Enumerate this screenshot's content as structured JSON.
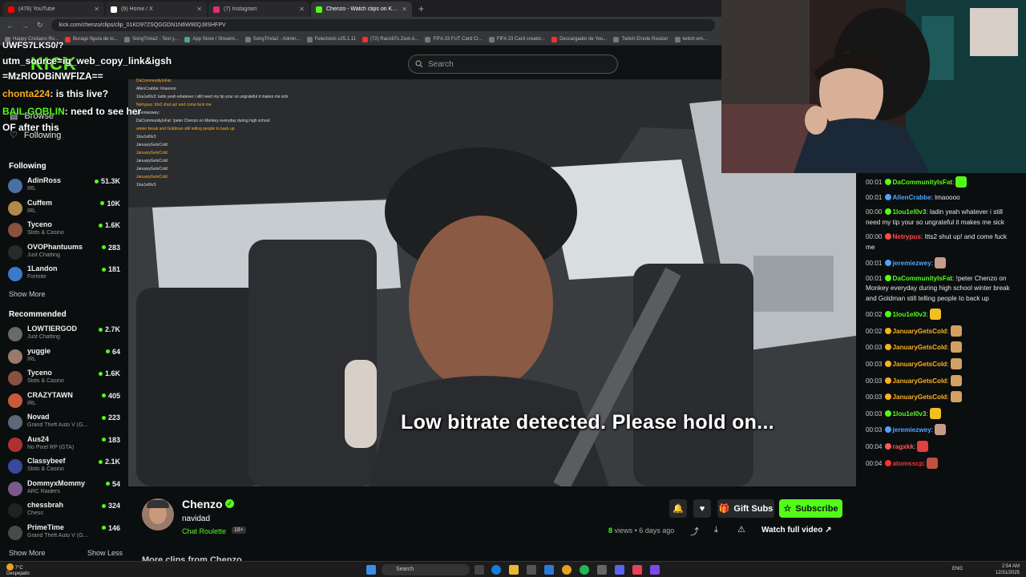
{
  "browser": {
    "tabs": [
      {
        "label": "(478) YouTube",
        "color": "#ff0000"
      },
      {
        "label": "(6) Home / X",
        "color": "#ffffff"
      },
      {
        "label": "(7) Instagram",
        "color": "#e1306c"
      },
      {
        "label": "Chenzo - Watch clips on Kick",
        "color": "#53fc18",
        "active": true
      }
    ],
    "url": "kick.com/chenzo/clips/clip_01KD97ZSQGGDN1N6W90QJ8SHFPV",
    "bookmarks": [
      "Happy Cristiano Ro...",
      "Burago figura de to...",
      "SongTrivia2 - Test y...",
      "App Store / Streami...",
      "SongTrivia2 - Admin...",
      "Felectools v25.1.11",
      "(72) Raco87s Zest-A...",
      "FIFA 23 FUT Card Cr...",
      "FIFA 23 Card creator...",
      "Descargador de You...",
      "Twitch Emote Resizer",
      "twitch em..."
    ]
  },
  "overlay": {
    "line1": "UWFS7LKS0/?",
    "line2": "utm_source=ig_web_copy_link&igsh",
    "line3": "=MzRlODBiNWFlZA==",
    "msg1_user": "chonta224",
    "msg1_text": ": is this live?",
    "msg2_user": "BAIL GOBLIN",
    "msg2_text": ": need to see her",
    "msg3": "OF after this"
  },
  "search": {
    "placeholder": "Search"
  },
  "sidebar": {
    "browse": "Browse",
    "following_nav": "Following",
    "following_title": "Following",
    "following": [
      {
        "name": "AdinRoss",
        "game": "IRL",
        "viewers": "51.3K",
        "color": "#4a6fa5"
      },
      {
        "name": "Cuffem",
        "game": "IRL",
        "viewers": "10K",
        "color": "#b08a4a"
      },
      {
        "name": "Tyceno",
        "game": "Slots & Casino",
        "viewers": "1.6K",
        "color": "#8a5040"
      },
      {
        "name": "OVOPhantuums",
        "game": "Just Chatting",
        "viewers": "283",
        "color": "#2a2a2a"
      },
      {
        "name": "1Landon",
        "game": "Fortnite",
        "viewers": "181",
        "color": "#3a7ac8"
      }
    ],
    "show_more_1": "Show More",
    "recommended_title": "Recommended",
    "recommended": [
      {
        "name": "LOWTIERGOD",
        "game": "Just Chatting",
        "viewers": "2.7K",
        "color": "#6a6a6a"
      },
      {
        "name": "yuggie",
        "game": "IRL",
        "viewers": "64",
        "color": "#9a7a6a"
      },
      {
        "name": "Tyceno",
        "game": "Slots & Casino",
        "viewers": "1.6K",
        "color": "#8a5040"
      },
      {
        "name": "CRAZYTAWN",
        "game": "IRL",
        "viewers": "405",
        "color": "#c85a3a"
      },
      {
        "name": "Novad",
        "game": "Grand Theft Auto V (G...",
        "viewers": "223",
        "color": "#5a6a7a"
      },
      {
        "name": "Aus24",
        "game": "No Pixel RP (GTA)",
        "viewers": "183",
        "color": "#b03030"
      },
      {
        "name": "Classybeef",
        "game": "Slots & Casino",
        "viewers": "2.1K",
        "color": "#3a4a9a"
      },
      {
        "name": "DommyxMommy",
        "game": "ARC Raiders",
        "viewers": "54",
        "color": "#7a5a8a"
      },
      {
        "name": "chessbrah",
        "game": "Chess",
        "viewers": "324",
        "color": "#222222"
      },
      {
        "name": "PrimeTime",
        "game": "Grand Theft Auto V (G...",
        "viewers": "146",
        "color": "#4a4a4a"
      }
    ],
    "show_more_2": "Show More",
    "show_less": "Show Less"
  },
  "video": {
    "notice": "Low bitrate detected. Please hold on...",
    "mini_chat": [
      "DaCommunityIsFat:",
      "AllenCrabbe: lmaoooo",
      "1lou1el0v3: ladin yeah whatever i still need my tip your so ungrateful it makes me sick",
      "Netrypus: Itts2 shut up! and come fuck me",
      "jeremiezwey:",
      "DaCommunityIsFat: !peter Chenzo on Monkey everyday during high school",
      "winter break and Goldman still telling people to back up",
      "1lou1el0v3:",
      "JanuaryGetsCold:",
      "JanuaryGetsCold:",
      "JanuaryGetsCold:",
      "JanuaryGetsCold:",
      "JanuaryGetsCold:",
      "1lou1el0v3:"
    ]
  },
  "clip": {
    "channel": "Chenzo",
    "title": "navidad",
    "category": "Chat Roulette",
    "age_badge": "18+",
    "views": "8",
    "views_suffix": "views",
    "age": "• 6 days ago",
    "gift_subs": "Gift Subs",
    "subscribe": "Subscribe",
    "watch_full": "Watch full video",
    "more_clips": "More clips from Chenzo"
  },
  "chat": [
    {
      "time": "00:01",
      "user": "DaCommunityIsFat",
      "color": "#53fc18",
      "text": "",
      "emote": "#53fc18"
    },
    {
      "time": "00:01",
      "user": "AllenCrabbe",
      "color": "#4fa3ff",
      "text": "lmaoooo"
    },
    {
      "time": "00:00",
      "user": "1lou1el0v3",
      "color": "#53fc18",
      "text": "ladin yeah whatever i still need my tip your so ungrateful it makes me sick"
    },
    {
      "time": "00:00",
      "user": "Netrypus",
      "color": "#ff4a4a",
      "text": "Itts2 shut up! and come fuck me"
    },
    {
      "time": "00:01",
      "user": "jeremiezwey",
      "color": "#4fa3ff",
      "text": "",
      "emote": "#c89a8a"
    },
    {
      "time": "00:01",
      "user": "DaCommunityIsFat",
      "color": "#53fc18",
      "text": "!peter Chenzo on Monkey everyday during high school winter break and Goldman still telling people to back up"
    },
    {
      "time": "00:02",
      "user": "1lou1el0v3",
      "color": "#53fc18",
      "text": "",
      "emote": "#f0c020"
    },
    {
      "time": "00:02",
      "user": "JanuaryGetsCold",
      "color": "#ffb020",
      "text": "",
      "emote": "#d4a060"
    },
    {
      "time": "00:03",
      "user": "JanuaryGetsCold",
      "color": "#ffb020",
      "text": "",
      "emote": "#d4a060"
    },
    {
      "time": "00:03",
      "user": "JanuaryGetsCold",
      "color": "#ffb020",
      "text": "",
      "emote": "#d4a060"
    },
    {
      "time": "00:03",
      "user": "JanuaryGetsCold",
      "color": "#ffb020",
      "text": "",
      "emote": "#d4a060"
    },
    {
      "time": "00:03",
      "user": "JanuaryGetsCold",
      "color": "#ffb020",
      "text": "",
      "emote": "#d4a060"
    },
    {
      "time": "00:03",
      "user": "1lou1el0v3",
      "color": "#53fc18",
      "text": "",
      "emote": "#f0c020"
    },
    {
      "time": "00:03",
      "user": "jeremiezwey",
      "color": "#4fa3ff",
      "text": "",
      "emote": "#c89a8a"
    },
    {
      "time": "00:04",
      "user": "ragxkk",
      "color": "#ff5a5a",
      "text": "",
      "emote": "#e04040"
    },
    {
      "time": "00:04",
      "user": "atomsscp",
      "color": "#ff3030",
      "text": "",
      "emote": "#c05040"
    }
  ],
  "taskbar": {
    "weather_temp": "7°C",
    "weather_desc": "Despejado",
    "search": "Search",
    "lang": "ENG",
    "time": "2:54 AM",
    "date": "12/31/2025"
  }
}
